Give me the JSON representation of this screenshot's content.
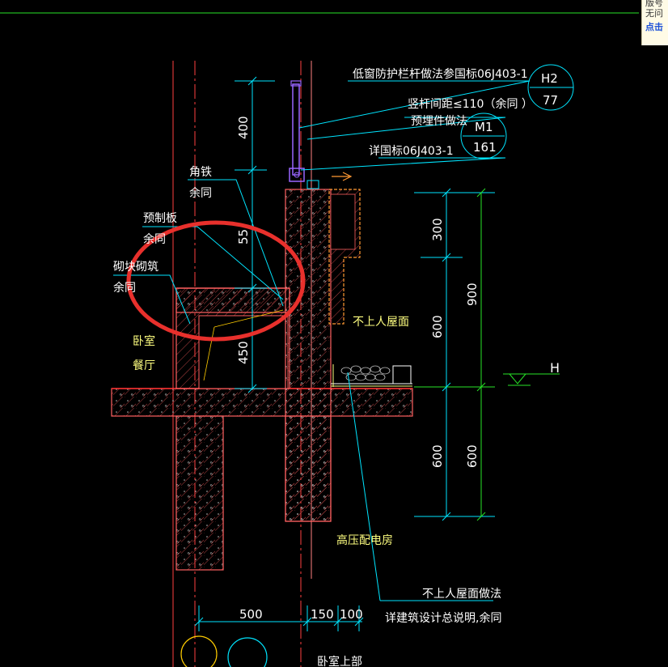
{
  "colors": {
    "background": "#000000",
    "wall_hatch": "#ff5a5a",
    "dimension": "#00e5ff",
    "dimension_green": "#27e327",
    "leader": "#00e5ff",
    "label": "#ffffff",
    "label_yellow": "#ffff80",
    "railing": "#9966ff",
    "highlight_circle": "#e8302c",
    "ground_line": "#ff3030"
  },
  "annotations": {
    "railing_ref": "低窗防护栏杆做法参国标06J403-1",
    "railing_badge_top": "H2",
    "railing_badge_bottom": "77",
    "baluster_spacing": "竖杆间距≤110（余同 ）",
    "embedded_part": "预埋件做法",
    "embedded_badge_top": "M1",
    "embedded_badge_bottom": "161",
    "embedded_ref": "详国标06J403-1",
    "angle_steel": "角铁",
    "angle_steel_note": "余同",
    "precast_slab": "预制板",
    "precast_slab_note": "余同",
    "masonry": "砌块砌筑",
    "masonry_note": "余同",
    "bedroom": "卧室",
    "dining": "餐厅",
    "roof_label": "不上人屋面",
    "substation": "高压配电房",
    "roof_method": "不上人屋面做法",
    "roof_method_ref": "详建筑设计总说明,余同",
    "level_mark": "H",
    "bottom_label": "卧室上部"
  },
  "dimensions": {
    "left_top": "400",
    "left_mid": "55",
    "left_low": "450",
    "right_1": "300",
    "right_2": "600",
    "right_3": "600",
    "right_total_upper": "900",
    "right_total_lower": "600",
    "bottom_1": "500",
    "bottom_2": "150",
    "bottom_3": "100"
  },
  "popup": {
    "line1": "版号",
    "line2": "无问",
    "line3": "点击"
  }
}
